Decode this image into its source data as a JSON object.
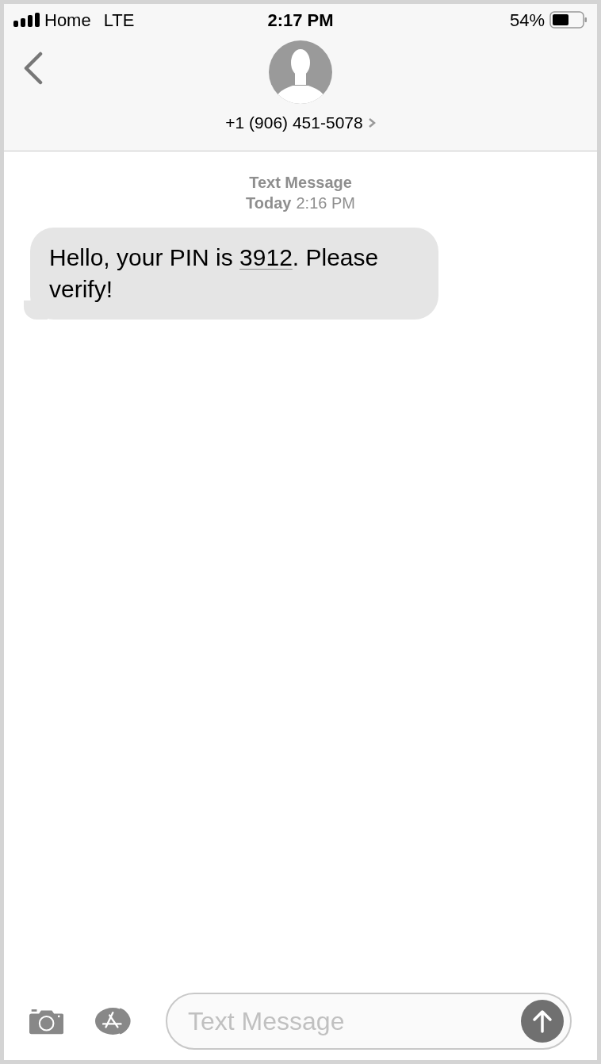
{
  "status_bar": {
    "carrier": "Home",
    "network": "LTE",
    "time": "2:17 PM",
    "battery": "54%"
  },
  "header": {
    "contact": "+1 (906) 451-5078"
  },
  "thread": {
    "service": "Text Message",
    "date": "Today",
    "time": "2:16 PM"
  },
  "messages": [
    {
      "kind": "incoming",
      "text_before": "Hello, your PIN is ",
      "link": "3912",
      "text_after": ". Please verify!"
    }
  ],
  "composer": {
    "placeholder": "Text Message"
  }
}
